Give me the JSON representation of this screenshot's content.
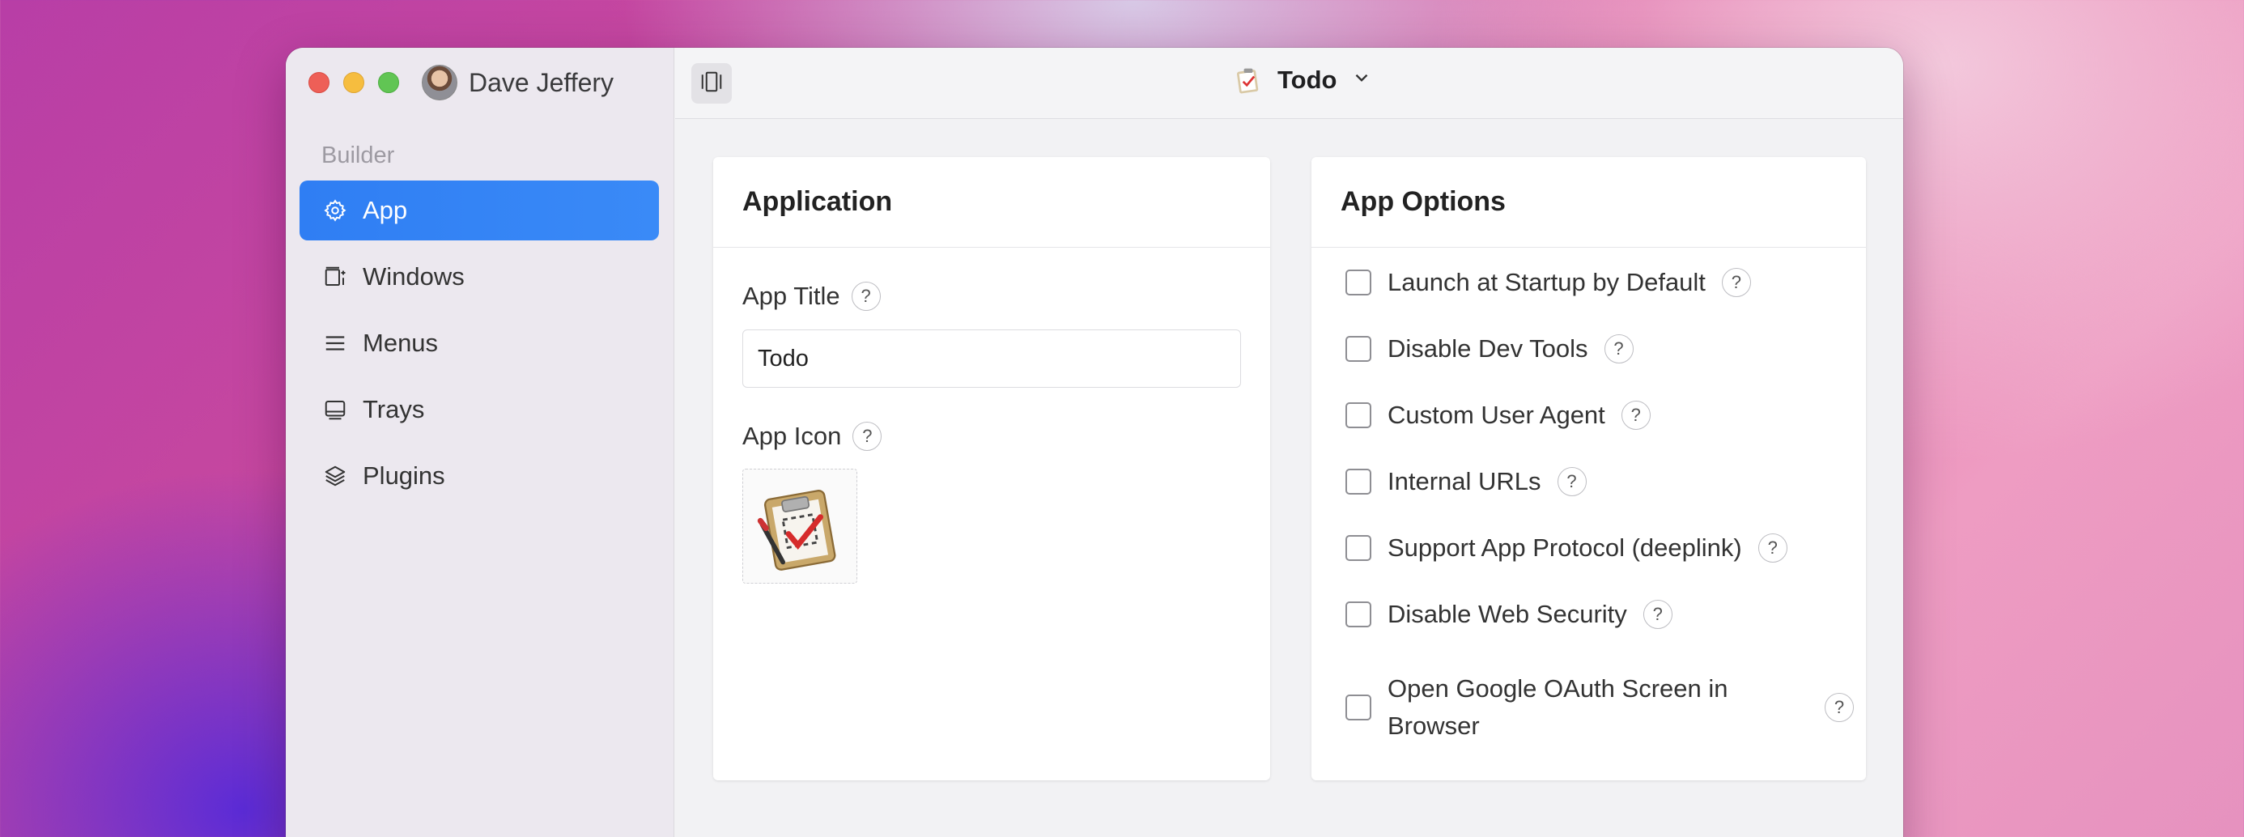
{
  "user": {
    "name": "Dave Jeffery"
  },
  "sidebar": {
    "section": "Builder",
    "items": [
      {
        "label": "App",
        "icon": "gear-icon",
        "active": true
      },
      {
        "label": "Windows",
        "icon": "windows-icon",
        "active": false
      },
      {
        "label": "Menus",
        "icon": "menu-lines-icon",
        "active": false
      },
      {
        "label": "Trays",
        "icon": "tray-icon",
        "active": false
      },
      {
        "label": "Plugins",
        "icon": "layers-icon",
        "active": false
      }
    ]
  },
  "header": {
    "project_title": "Todo"
  },
  "application": {
    "title": "Application",
    "app_title_label": "App Title",
    "app_title_value": "Todo",
    "app_icon_label": "App Icon",
    "help_glyph": "?"
  },
  "app_options": {
    "title": "App Options",
    "options": [
      {
        "label": "Launch at Startup by Default",
        "checked": false
      },
      {
        "label": "Disable Dev Tools",
        "checked": false
      },
      {
        "label": "Custom User Agent",
        "checked": false
      },
      {
        "label": "Internal URLs",
        "checked": false
      },
      {
        "label": "Support App Protocol (deeplink)",
        "checked": false
      },
      {
        "label": "Disable Web Security",
        "checked": false
      },
      {
        "label": "Open Google OAuth Screen in Browser",
        "checked": false
      }
    ]
  },
  "colors": {
    "accent": "#2f7ef3",
    "traffic_red": "#ee5f57",
    "traffic_yellow": "#f6bd3f",
    "traffic_green": "#61c554"
  }
}
